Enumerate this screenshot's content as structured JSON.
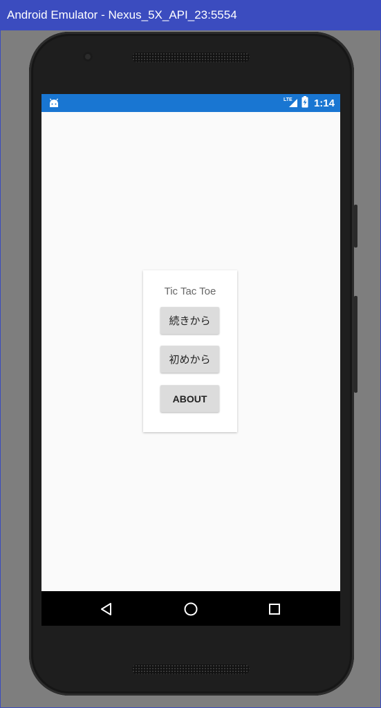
{
  "window": {
    "title": "Android Emulator - Nexus_5X_API_23:5554"
  },
  "statusbar": {
    "network": "LTE",
    "time": "1:14",
    "color": "#1976d2",
    "icons": [
      "android-icon",
      "lte-signal-icon",
      "battery-charging-icon"
    ]
  },
  "dialog": {
    "title": "Tic Tac Toe",
    "buttons": [
      {
        "label": "続きから"
      },
      {
        "label": "初めから"
      },
      {
        "label": "ABOUT"
      }
    ]
  },
  "navbar": {
    "icons": [
      "back-icon",
      "home-icon",
      "recent-apps-icon"
    ]
  }
}
